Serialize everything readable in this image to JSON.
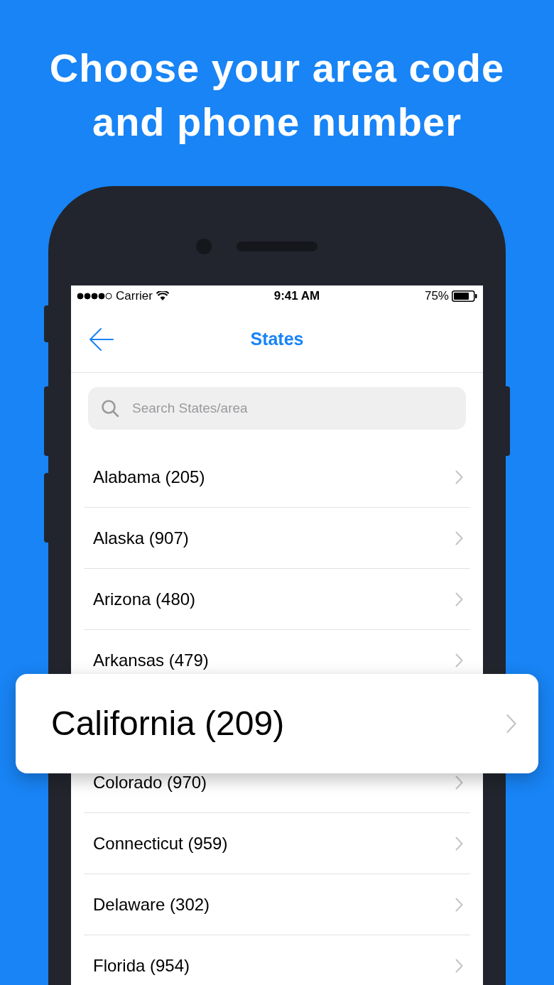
{
  "headline": [
    "Choose your area code",
    "and phone number"
  ],
  "status_bar": {
    "carrier": "Carrier",
    "time": "9:41 AM",
    "battery": "75%"
  },
  "nav": {
    "title": "States"
  },
  "search": {
    "placeholder": "Search States/area"
  },
  "states": [
    {
      "label": "Alabama (205)",
      "selected": false
    },
    {
      "label": "Alaska (907)",
      "selected": false
    },
    {
      "label": "Arizona (480)",
      "selected": false
    },
    {
      "label": "Arkansas (479)",
      "selected": false
    },
    {
      "label": "California (209)",
      "selected": true
    },
    {
      "label": "Colorado (970)",
      "selected": false
    },
    {
      "label": "Connecticut (959)",
      "selected": false
    },
    {
      "label": "Delaware (302)",
      "selected": false
    },
    {
      "label": "Florida (954)",
      "selected": false
    }
  ]
}
